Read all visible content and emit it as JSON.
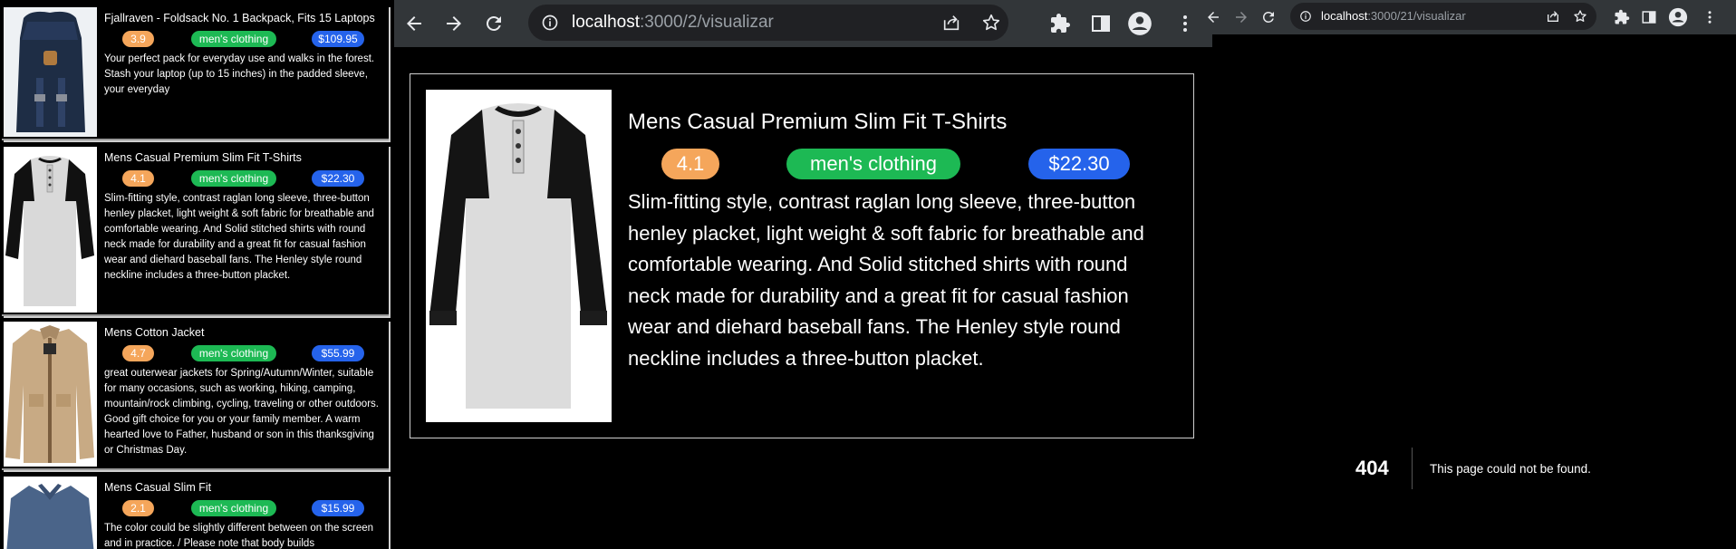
{
  "list": {
    "items": [
      {
        "title": "Fjallraven - Foldsack No. 1 Backpack, Fits 15 Laptops",
        "rating": "3.9",
        "category": "men's clothing",
        "price": "$109.95",
        "description": "Your perfect pack for everyday use and walks in the forest. Stash your laptop (up to 15 inches) in the padded sleeve, your everyday"
      },
      {
        "title": "Mens Casual Premium Slim Fit T-Shirts",
        "rating": "4.1",
        "category": "men's clothing",
        "price": "$22.30",
        "description": "Slim-fitting style, contrast raglan long sleeve, three-button henley placket, light weight & soft fabric for breathable and comfortable wearing. And Solid stitched shirts with round neck made for durability and a great fit for casual fashion wear and diehard baseball fans. The Henley style round neckline includes a three-button placket."
      },
      {
        "title": "Mens Cotton Jacket",
        "rating": "4.7",
        "category": "men's clothing",
        "price": "$55.99",
        "description": "great outerwear jackets for Spring/Autumn/Winter, suitable for many occasions, such as working, hiking, camping, mountain/rock climbing, cycling, traveling or other outdoors. Good gift choice for you or your family member. A warm hearted love to Father, husband or son in this thanksgiving or Christmas Day."
      },
      {
        "title": "Mens Casual Slim Fit",
        "rating": "2.1",
        "category": "men's clothing",
        "price": "$15.99",
        "description": "The color could be slightly different between on the screen and in practice. / Please note that body builds"
      }
    ]
  },
  "middle_browser": {
    "url_host": "localhost",
    "url_path": ":3000/2/visualizar",
    "product": {
      "title": "Mens Casual Premium Slim Fit T-Shirts",
      "rating": "4.1",
      "category": "men's clothing",
      "price": "$22.30",
      "description": "Slim-fitting style, contrast raglan long sleeve, three-button henley placket, light weight & soft fabric for breathable and comfortable wearing. And Solid stitched shirts with round neck made for durability and a great fit for casual fashion wear and diehard baseball fans. The Henley style round neckline includes a three-button placket."
    }
  },
  "right_browser": {
    "url_host": "localhost",
    "url_path": ":3000/21/visualizar",
    "error_code": "404",
    "error_message": "This page could not be found."
  },
  "colors": {
    "rating_badge": "#f5a65b",
    "category_badge": "#1db954",
    "price_badge": "#2563eb",
    "chrome_bar": "#323639",
    "omnibox": "#202124"
  },
  "icons": [
    "back-icon",
    "forward-icon",
    "reload-icon",
    "info-icon",
    "share-icon",
    "star-icon",
    "extensions-icon",
    "sidepanel-icon",
    "profile-icon",
    "menu-icon"
  ]
}
